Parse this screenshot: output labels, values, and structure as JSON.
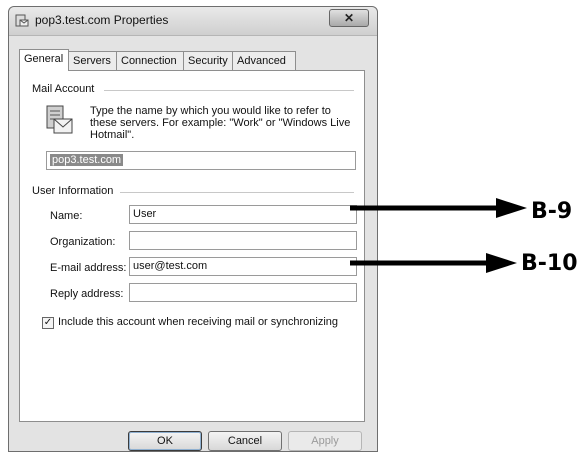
{
  "window": {
    "title": "pop3.test.com Properties",
    "close_glyph": "✕"
  },
  "tabs": [
    {
      "label": "General",
      "active": true
    },
    {
      "label": "Servers",
      "active": false
    },
    {
      "label": "Connection",
      "active": false
    },
    {
      "label": "Security",
      "active": false
    },
    {
      "label": "Advanced",
      "active": false
    }
  ],
  "mail_account": {
    "group_label": "Mail Account",
    "description": "Type the name by which you would like to refer to these servers.  For example: \"Work\" or \"Windows Live Hotmail\".",
    "account_name": "pop3.test.com"
  },
  "user_information": {
    "group_label": "User Information",
    "name_label": "Name:",
    "name_value": "User",
    "organization_label": "Organization:",
    "organization_value": "",
    "email_label": "E-mail address:",
    "email_value": "user@test.com",
    "reply_label": "Reply address:",
    "reply_value": ""
  },
  "include_account": {
    "checked": true,
    "label": "Include this account when receiving mail or synchronizing"
  },
  "buttons": {
    "ok": "OK",
    "cancel": "Cancel",
    "apply": "Apply"
  },
  "annotations": {
    "b9": "B-9",
    "b10": "B-10"
  }
}
